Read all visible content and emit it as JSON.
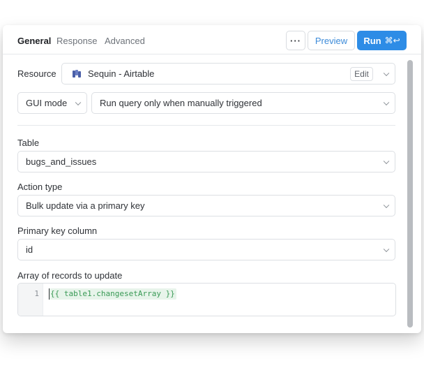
{
  "tabs": [
    {
      "label": "General",
      "active": true
    },
    {
      "label": "Response",
      "active": false
    },
    {
      "label": "Advanced",
      "active": false
    }
  ],
  "toolbar": {
    "more_label": "···",
    "preview_label": "Preview",
    "run_label": "Run",
    "run_shortcut": "⌘↩"
  },
  "resource": {
    "label": "Resource",
    "value": "Sequin - Airtable",
    "icon": "sequin-logo-icon",
    "edit_label": "Edit"
  },
  "mode": {
    "value": "GUI mode",
    "trigger": "Run query only when manually triggered"
  },
  "table": {
    "label": "Table",
    "value": "bugs_and_issues"
  },
  "action_type": {
    "label": "Action type",
    "value": "Bulk update via a primary key"
  },
  "primary_key": {
    "label": "Primary key column",
    "value": "id"
  },
  "records": {
    "label": "Array of records to update",
    "line_number": "1",
    "code": "{{ table1.changesetArray }}"
  },
  "colors": {
    "accent": "#2d8ce6",
    "preview_text": "#3d8bd9",
    "code_green": "#3a9a56"
  }
}
